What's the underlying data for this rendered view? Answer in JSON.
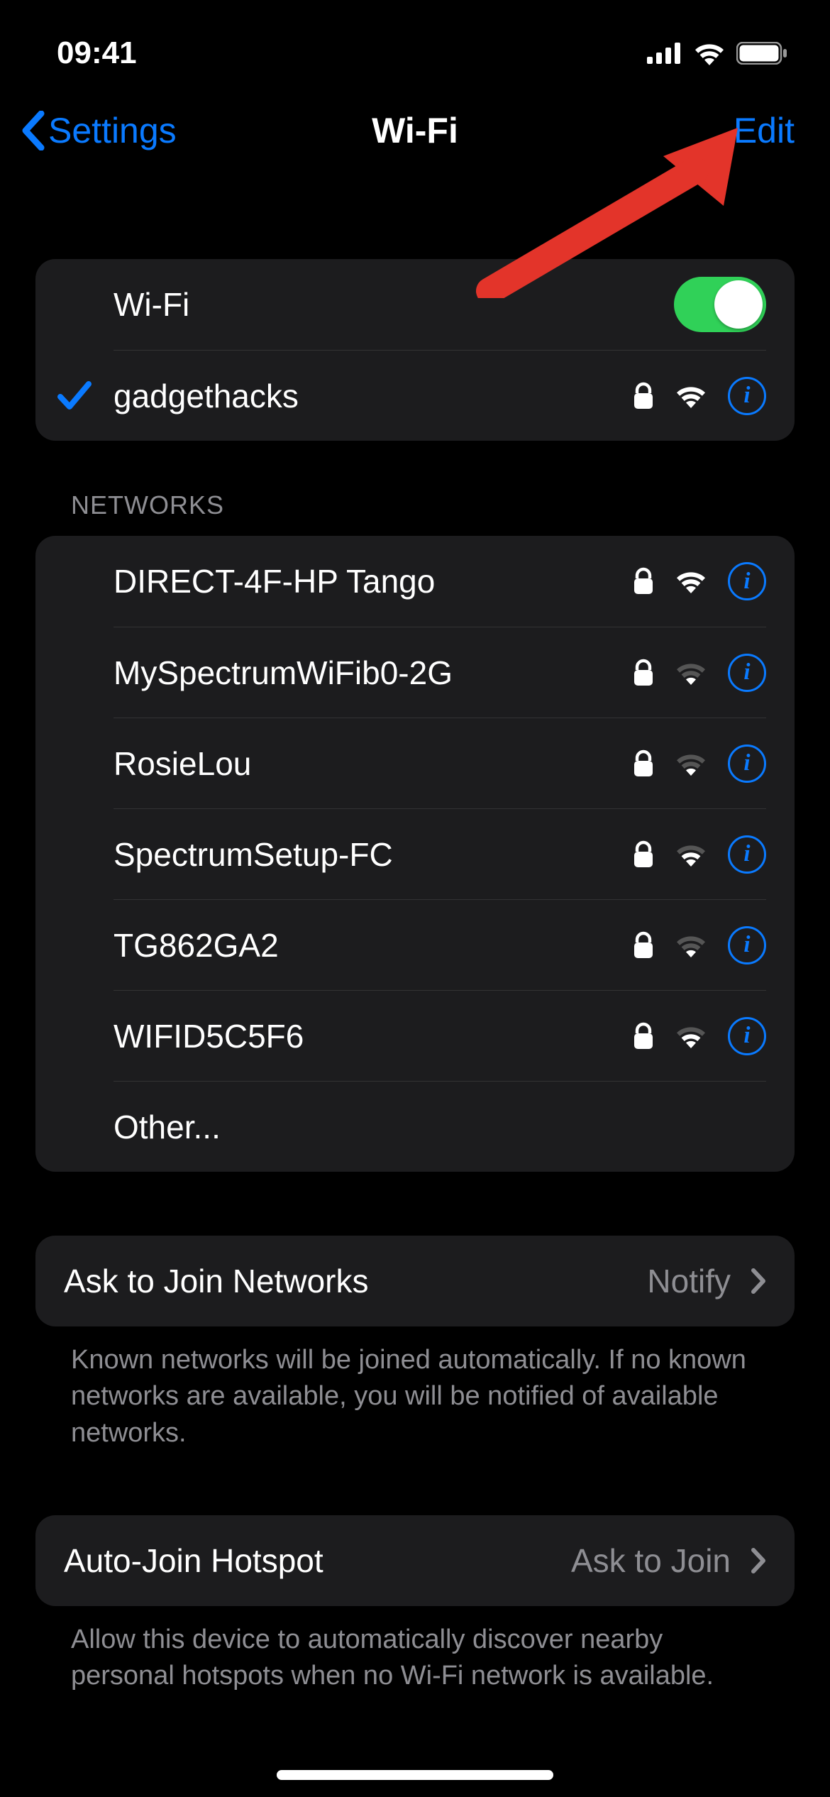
{
  "status": {
    "time": "09:41"
  },
  "nav": {
    "back": "Settings",
    "title": "Wi-Fi",
    "edit": "Edit"
  },
  "wifi": {
    "toggleLabel": "Wi-Fi",
    "connected": {
      "name": "gadgethacks"
    }
  },
  "networksHeader": "NETWORKS",
  "networks": [
    {
      "name": "DIRECT-4F-HP Tango",
      "signal": "strong"
    },
    {
      "name": "MySpectrumWiFib0-2G",
      "signal": "weak"
    },
    {
      "name": "RosieLou",
      "signal": "weak"
    },
    {
      "name": "SpectrumSetup-FC",
      "signal": "medium"
    },
    {
      "name": "TG862GA2",
      "signal": "weak"
    },
    {
      "name": "WIFID5C5F6",
      "signal": "medium"
    }
  ],
  "otherLabel": "Other...",
  "askJoin": {
    "label": "Ask to Join Networks",
    "value": "Notify",
    "footer": "Known networks will be joined automatically. If no known networks are available, you will be notified of available networks."
  },
  "autoHotspot": {
    "label": "Auto-Join Hotspot",
    "value": "Ask to Join",
    "footer": "Allow this device to automatically discover nearby personal hotspots when no Wi-Fi network is available."
  }
}
